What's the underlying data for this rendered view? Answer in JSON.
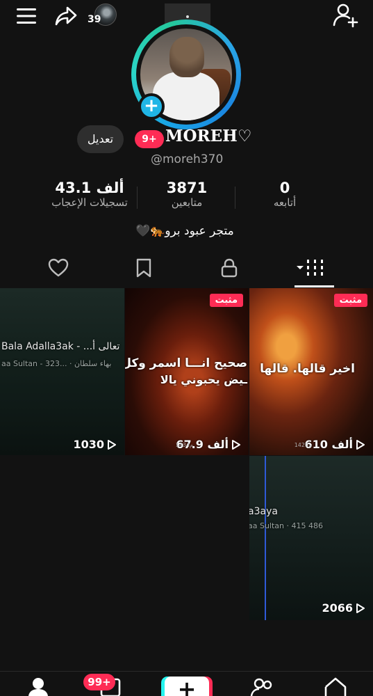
{
  "topbar": {
    "notification_count": "39",
    "menu_icon": "hamburger-icon",
    "share_icon": "share-icon",
    "add_user_icon": "add-user-icon",
    "notch_dot": "·"
  },
  "profile": {
    "username": "MOREH♡",
    "handle": "@moreh370",
    "badge": "9+",
    "edit_label": "تعديل",
    "bio": "متجر عبود برو🐅🖤"
  },
  "stats": [
    {
      "value": "0",
      "label": "أتابعه"
    },
    {
      "value": "3871",
      "label": "متابعين"
    },
    {
      "value": "43.1 ألف",
      "label": "تسجيلات الإعجاب"
    }
  ],
  "tabs": [
    {
      "icon": "videos-grid-icon",
      "active": true
    },
    {
      "icon": "lock-icon",
      "active": false
    },
    {
      "icon": "bookmark-icon",
      "active": false
    },
    {
      "icon": "heart-icon",
      "active": false
    }
  ],
  "videos": [
    {
      "pinned_label": "مثبت",
      "views": "610 ألف",
      "small": "1429م",
      "text": "اخير قالها. قالها"
    },
    {
      "pinned_label": "مثبت",
      "views": "67.9 ألف",
      "small": "1434م",
      "text1": "صحيح انـــا اسمر وكل",
      "text2": "ـيض يحبوني يالا"
    },
    {
      "views": "1030",
      "title": "Bala Adalla3ak - ...تعالى أ",
      "subtitle": "aa Sultan - 323... · بهاء سلطان"
    },
    {
      "views": "2066",
      "title": "a3aya",
      "subtitle": "aa Sultan · 415 486"
    }
  ],
  "bottom_nav": {
    "inbox_badge": "99+",
    "create_label": "+"
  },
  "colors": {
    "accent": "#fe2c55",
    "cyan": "#25f4ee",
    "background": "#121212"
  }
}
